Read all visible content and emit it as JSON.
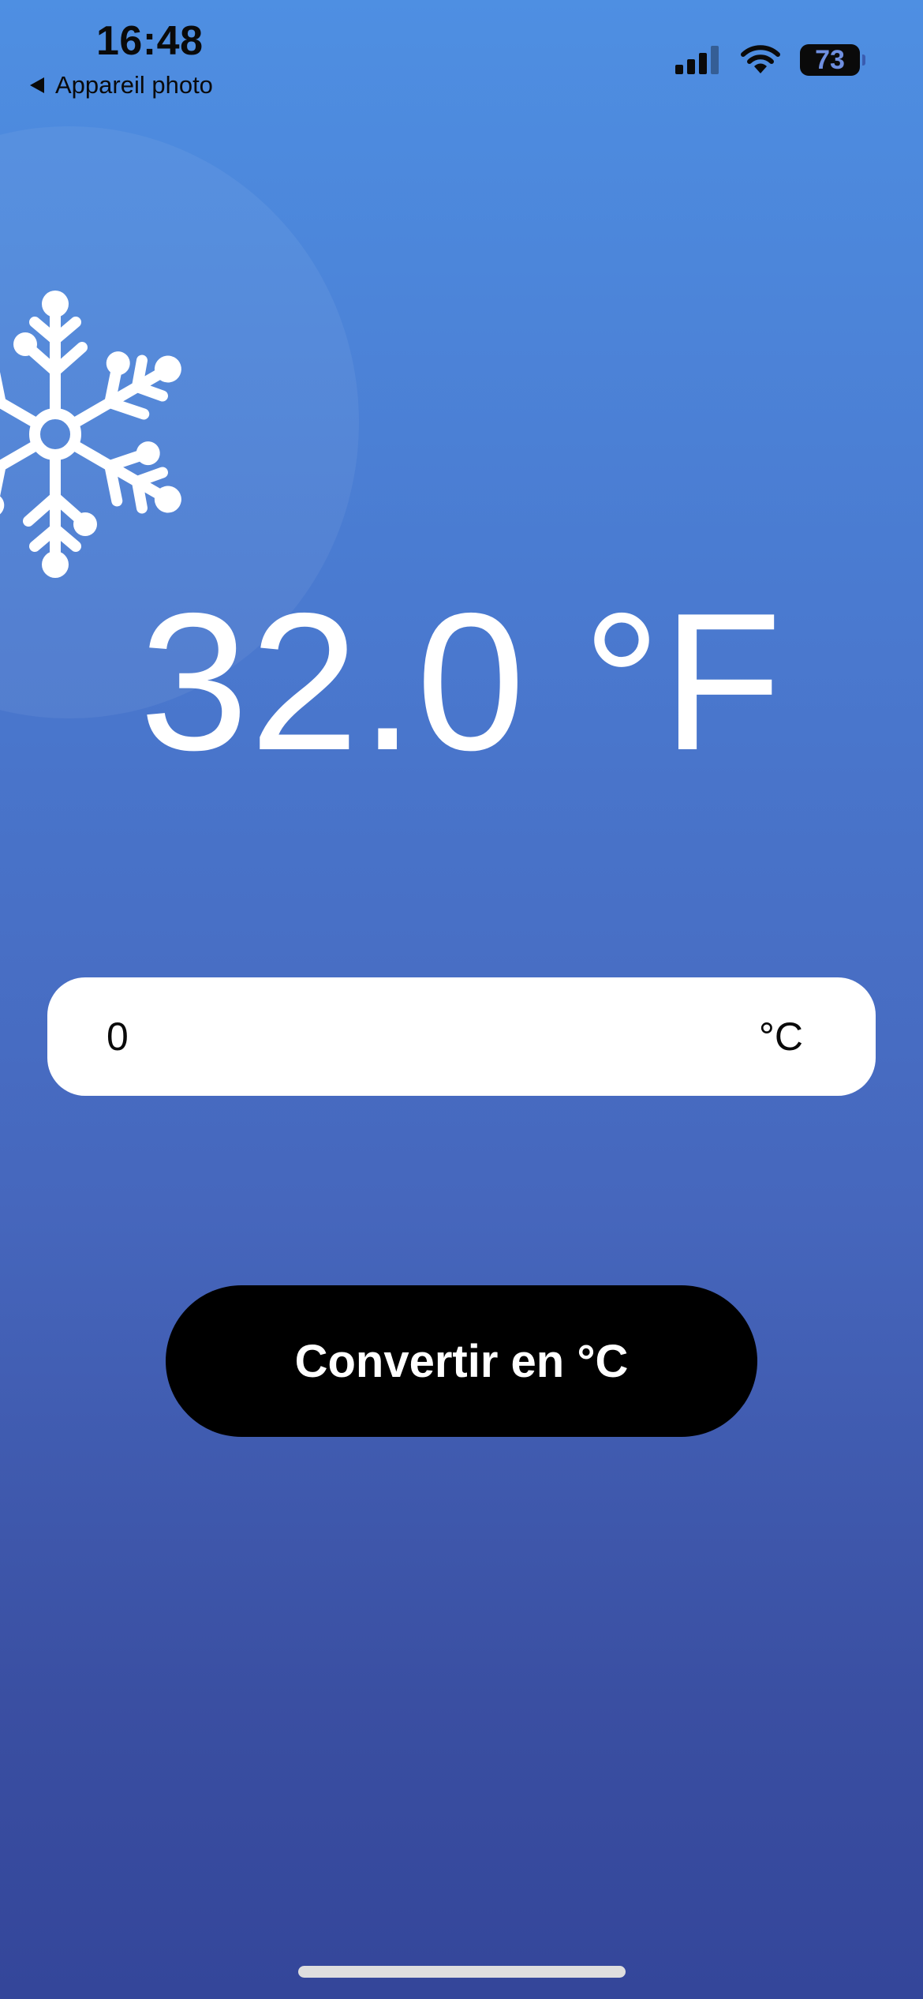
{
  "status_bar": {
    "time": "16:48",
    "back_label": "Appareil photo",
    "battery_level": "73",
    "signal_icon": "cellular-signal-icon",
    "wifi_icon": "wifi-icon"
  },
  "decoration": {
    "icon": "snowflake-icon"
  },
  "temperature": {
    "display": "32.0 °F"
  },
  "input": {
    "value": "0",
    "unit": "°C"
  },
  "button": {
    "label": "Convertir en °C"
  },
  "colors": {
    "background_top": "#4e8fe2",
    "background_bottom": "#34469a",
    "button": "#000000",
    "text_on_bg": "#ffffff"
  }
}
